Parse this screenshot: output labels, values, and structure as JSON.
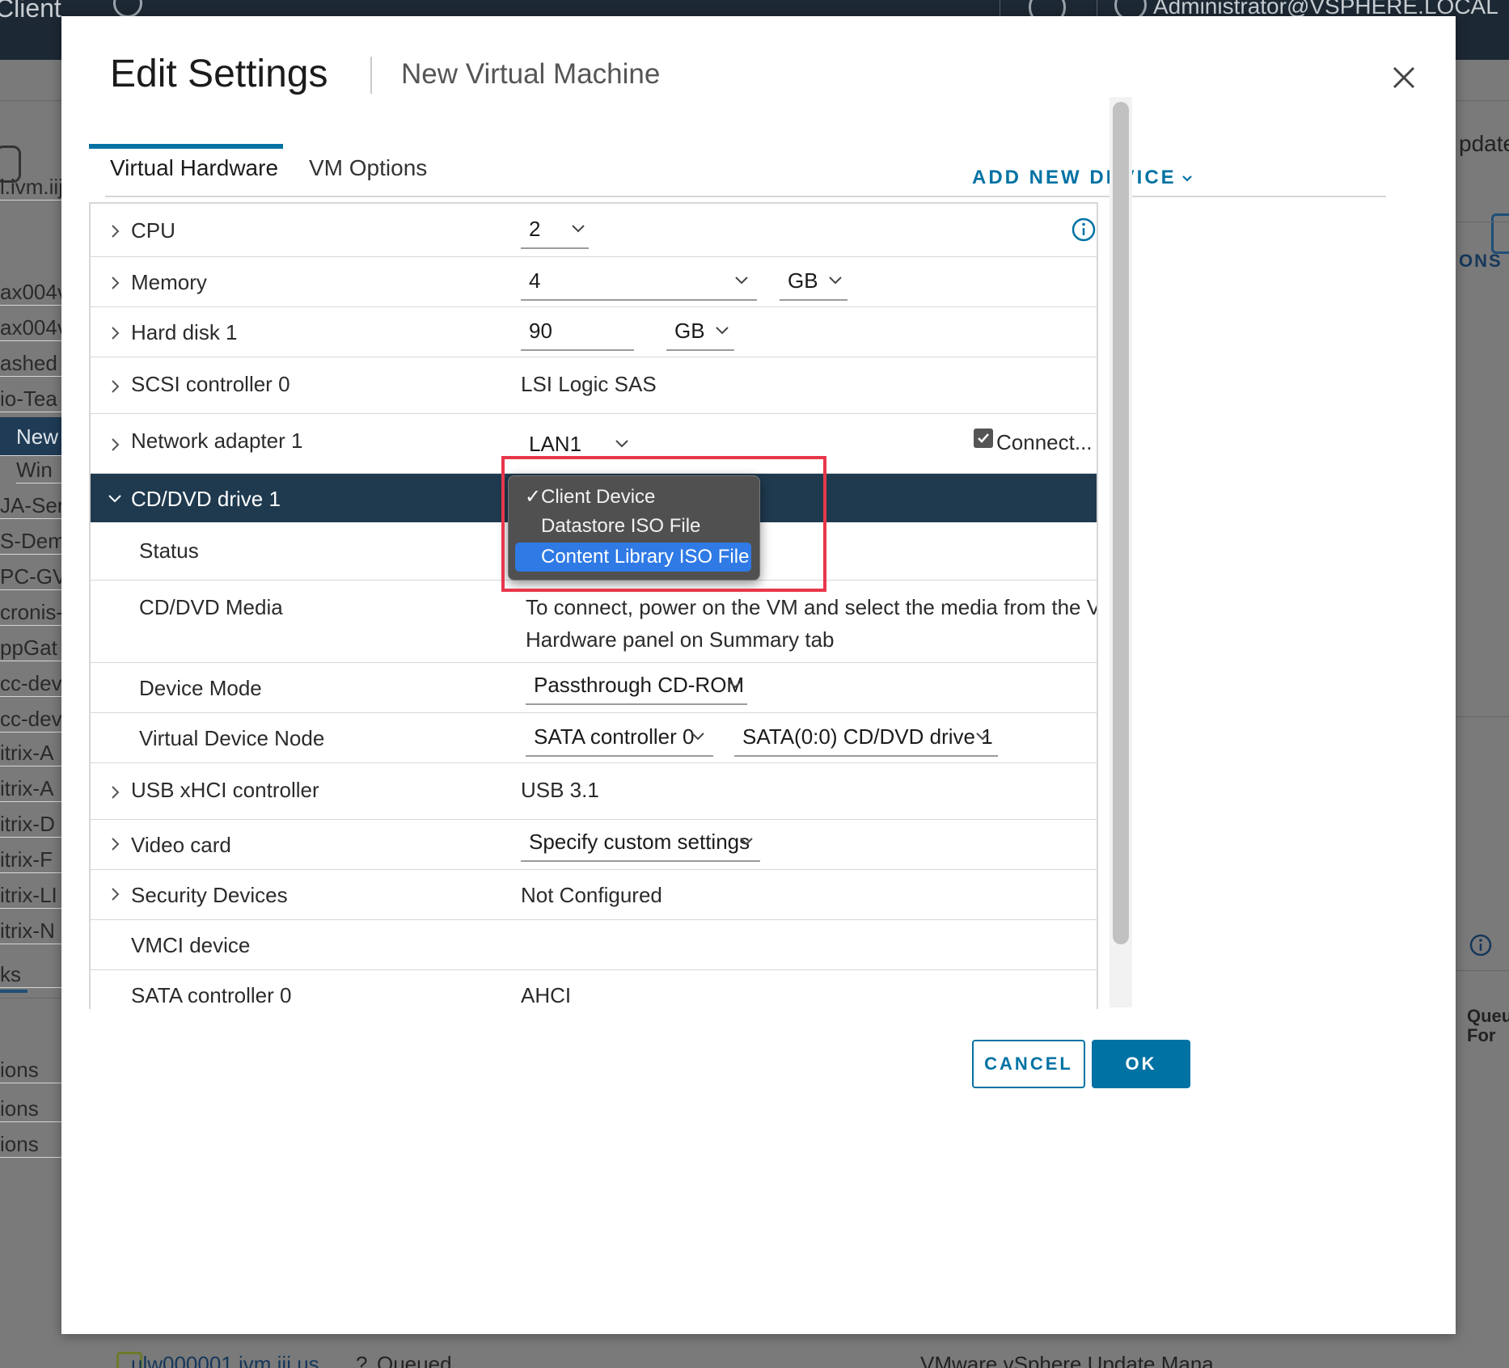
{
  "background": {
    "brand": "Client",
    "user": "Administrator@VSPHERE.LOCAL",
    "left_items": [
      "l.ivm.iij",
      "ax004v",
      "ax004v",
      "ashed",
      "io-Tea",
      "New",
      "Win",
      "JA-Ser",
      "S-Dem",
      "PC-GV",
      "cronis-",
      "ppGat",
      "cc-dev",
      "cc-dev",
      "itrix-A",
      "itrix-A",
      "itrix-D",
      "itrix-F",
      "itrix-LI",
      "itrix-N"
    ],
    "left_tab": "ks",
    "left_bottom": [
      "ions",
      "ions",
      "ions"
    ],
    "right_items": {
      "update": "pdate",
      "actions": "ONS",
      "queued_for": "Queu",
      "queued_for2": "For"
    },
    "bottom": {
      "vm_link": "ulw000001.ivm.iij.us",
      "status_q": "?",
      "status": "Queued",
      "target": "VMware vSphere Update Mana..."
    }
  },
  "dialog": {
    "title": "Edit Settings",
    "subtitle": "New Virtual Machine",
    "tabs": [
      "Virtual Hardware",
      "VM Options"
    ],
    "add_device": "ADD NEW DEVICE",
    "cancel": "CANCEL",
    "ok": "OK"
  },
  "hardware": {
    "cpu": {
      "label": "CPU",
      "value": "2"
    },
    "memory": {
      "label": "Memory",
      "value": "4",
      "unit": "GB"
    },
    "hard_disk": {
      "label": "Hard disk 1",
      "value": "90",
      "unit": "GB"
    },
    "scsi": {
      "label": "SCSI controller 0",
      "value": "LSI Logic SAS"
    },
    "network": {
      "label": "Network adapter 1",
      "value": "LAN1",
      "connect": "Connect..."
    },
    "cd_dvd": {
      "label": "CD/DVD drive 1",
      "status_label": "Status",
      "media_label": "CD/DVD Media",
      "media_text_1": "To connect, power on the VM and select the media from the VM",
      "media_text_2": "Hardware panel on Summary tab",
      "device_mode_label": "Device Mode",
      "device_mode_value": "Passthrough CD-ROM",
      "vdn_label": "Virtual Device Node",
      "vdn_controller": "SATA controller 0",
      "vdn_node": "SATA(0:0) CD/DVD drive 1"
    },
    "usb": {
      "label": "USB xHCI controller",
      "value": "USB 3.1"
    },
    "video": {
      "label": "Video card",
      "value": "Specify custom settings"
    },
    "security": {
      "label": "Security Devices",
      "value": "Not Configured"
    },
    "vmci": {
      "label": "VMCI device"
    },
    "sata": {
      "label": "SATA controller 0",
      "value": "AHCI"
    }
  },
  "dropdown": {
    "options": [
      "Client Device",
      "Datastore ISO File",
      "Content Library ISO File"
    ],
    "checked_index": 0,
    "highlighted_index": 2,
    "check_mark": "✓"
  },
  "colors": {
    "accent": "#0072a3",
    "selected_row": "#1f3a4f",
    "highlight": "#2f7ae5",
    "annotation": "#e8374a"
  }
}
